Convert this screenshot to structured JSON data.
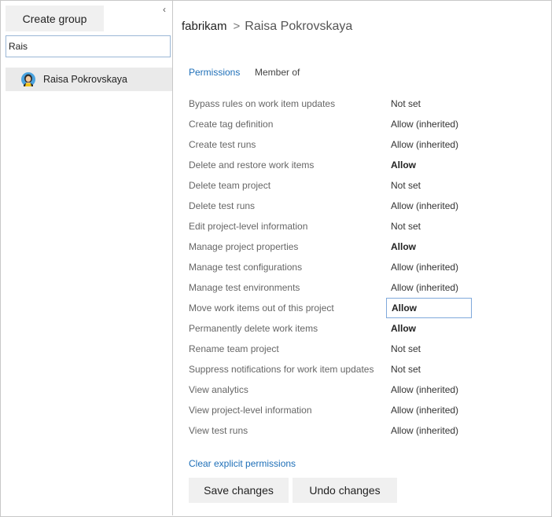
{
  "sidebar": {
    "create_group_label": "Create group",
    "collapse_glyph": "‹",
    "search_value": "Rais",
    "results": [
      {
        "name": "Raisa Pokrovskaya",
        "avatar_icon": "user-avatar"
      }
    ]
  },
  "breadcrumb": {
    "org": "fabrikam",
    "separator": ">",
    "user": "Raisa Pokrovskaya"
  },
  "tabs": [
    {
      "label": "Permissions",
      "active": true
    },
    {
      "label": "Member of",
      "active": false
    }
  ],
  "permissions": [
    {
      "name": "Bypass rules on work item updates",
      "value": "Not set",
      "bold": false
    },
    {
      "name": "Create tag definition",
      "value": "Allow (inherited)",
      "bold": false
    },
    {
      "name": "Create test runs",
      "value": "Allow (inherited)",
      "bold": false
    },
    {
      "name": "Delete and restore work items",
      "value": "Allow",
      "bold": true
    },
    {
      "name": "Delete team project",
      "value": "Not set",
      "bold": false
    },
    {
      "name": "Delete test runs",
      "value": "Allow (inherited)",
      "bold": false
    },
    {
      "name": "Edit project-level information",
      "value": "Not set",
      "bold": false
    },
    {
      "name": "Manage project properties",
      "value": "Allow",
      "bold": true
    },
    {
      "name": "Manage test configurations",
      "value": "Allow (inherited)",
      "bold": false
    },
    {
      "name": "Manage test environments",
      "value": "Allow (inherited)",
      "bold": false
    },
    {
      "name": "Move work items out of this project",
      "value": "Allow",
      "bold": true,
      "selected": true
    },
    {
      "name": "Permanently delete work items",
      "value": "Allow",
      "bold": true
    },
    {
      "name": "Rename team project",
      "value": "Not set",
      "bold": false
    },
    {
      "name": "Suppress notifications for work item updates",
      "value": "Not set",
      "bold": false
    },
    {
      "name": "View analytics",
      "value": "Allow (inherited)",
      "bold": false
    },
    {
      "name": "View project-level information",
      "value": "Allow (inherited)",
      "bold": false
    },
    {
      "name": "View test runs",
      "value": "Allow (inherited)",
      "bold": false
    }
  ],
  "footer": {
    "clear_link": "Clear explicit permissions",
    "save_label": "Save changes",
    "undo_label": "Undo changes"
  },
  "colors": {
    "accent": "#1e6fb8",
    "selected_bg": "#eaeaea",
    "button_bg": "#f0f0f0"
  }
}
